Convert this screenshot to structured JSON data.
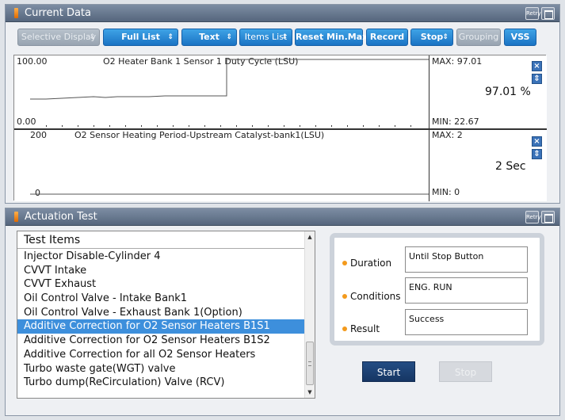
{
  "current_data": {
    "title": "Current Data",
    "retry_label": "Retry",
    "toolbar": {
      "selective_display": "Selective Display",
      "full_list": "Full List",
      "text": "Text",
      "items_list": "Items List",
      "reset_min_max": "Reset Min.Max",
      "record": "Record",
      "stop": "Stop",
      "grouping": "Grouping",
      "vss": "VSS"
    },
    "graphs": [
      {
        "axis_top": "100.00",
        "axis_bottom": "0.00",
        "label": "O2 Heater Bank 1 Sensor 1 Duty Cycle (LSU)",
        "max": "MAX: 97.01",
        "min": "MIN: 22.67",
        "value": "97.01 %"
      },
      {
        "axis_top": "200",
        "axis_bottom": "0",
        "label": "O2 Sensor Heating Period-Upstream Catalyst-bank1(LSU)",
        "max": "MAX: 2",
        "min": "MIN: 0",
        "value": "2 Sec"
      }
    ]
  },
  "actuation_test": {
    "title": "Actuation Test",
    "retry_label": "Retry",
    "list_header": "Test Items",
    "items": [
      "Injector Disable-Cylinder 4",
      "CVVT Intake",
      "CVVT Exhaust",
      "Oil Control Valve - Intake Bank1",
      "Oil Control Valve - Exhaust Bank 1(Option)",
      "Additive Correction for O2 Sensor Heaters B1S1",
      "Additive Correction for O2 Sensor Heaters B1S2",
      "Additive Correction for all O2 Sensor Heaters",
      "Turbo waste gate(WGT) valve",
      "Turbo dump(ReCirculation) Valve (RCV)"
    ],
    "selected_index": 5,
    "duration_label": "Duration",
    "duration_value": "Until Stop Button",
    "conditions_label": "Conditions",
    "conditions_value": "ENG. RUN",
    "result_label": "Result",
    "result_value": "Success",
    "start_label": "Start",
    "stop_label": "Stop"
  },
  "colors": {
    "accent": "#1a73c4",
    "selection": "#3d8fdc",
    "title_bar": "#55667d",
    "orange_marker": "#f39a1c"
  }
}
